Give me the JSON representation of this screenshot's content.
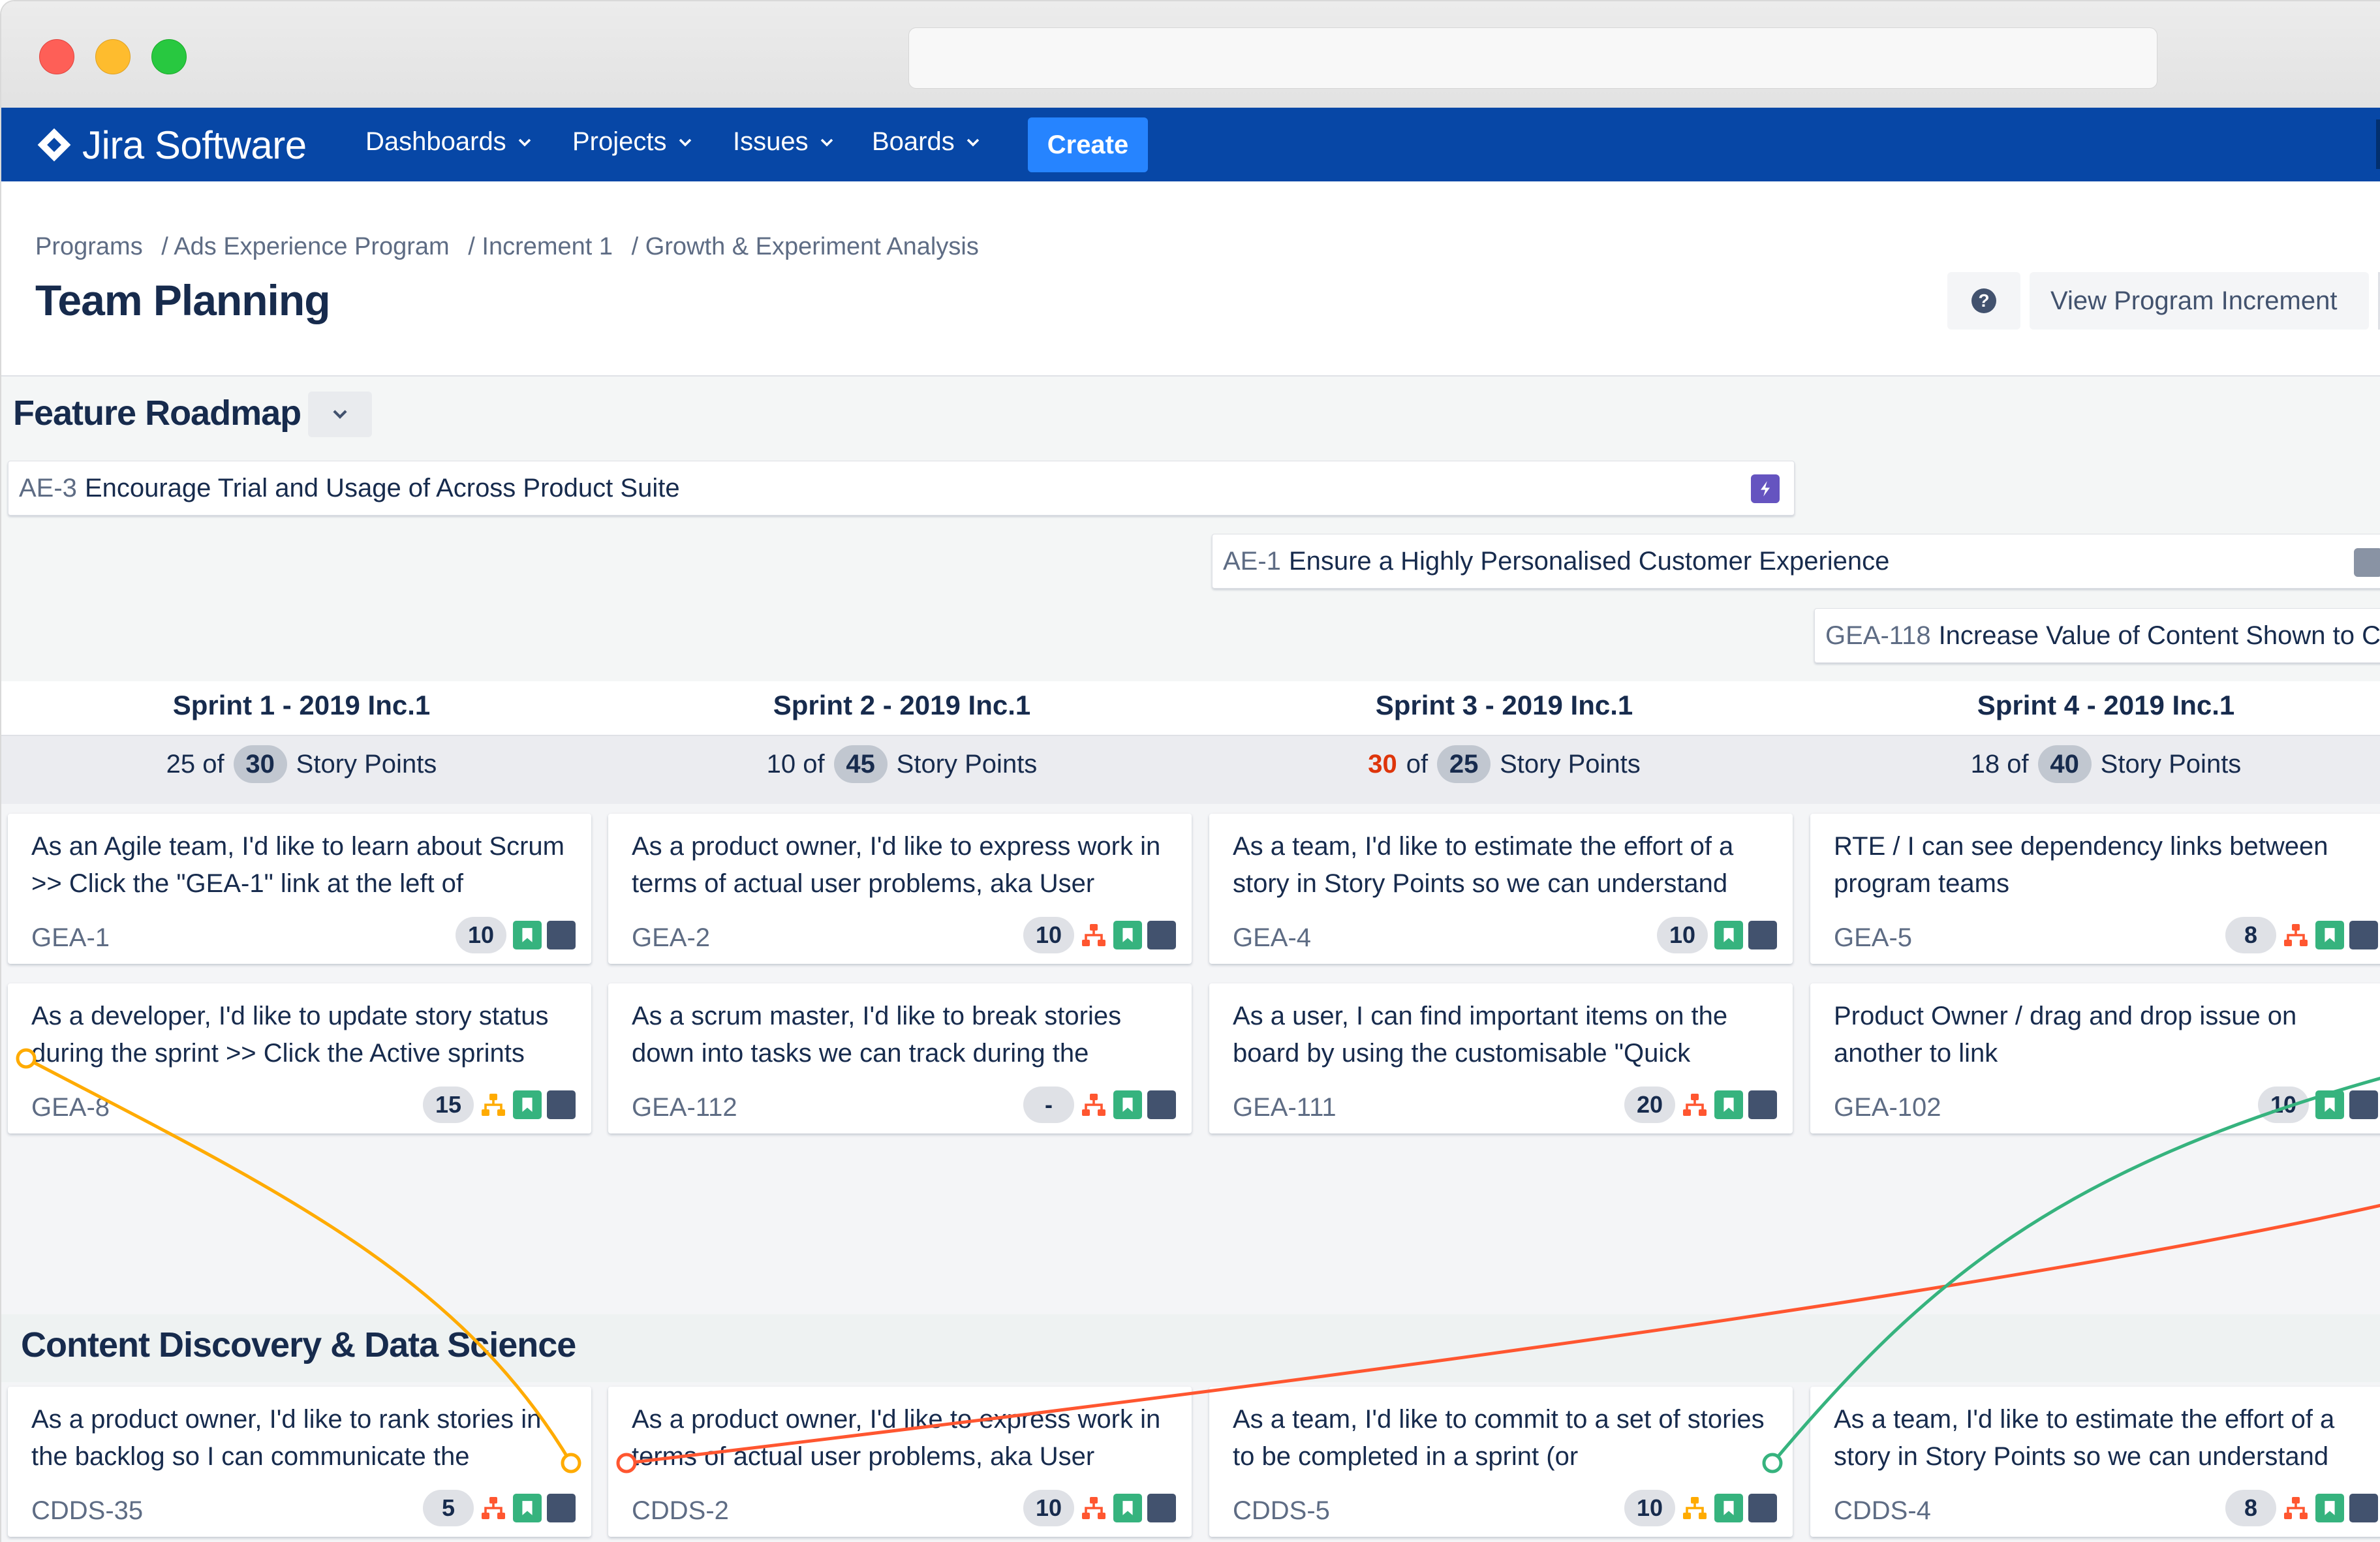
{
  "nav": {
    "brand": "Jira Software",
    "items": [
      {
        "label": "Dashboards"
      },
      {
        "label": "Projects"
      },
      {
        "label": "Issues"
      },
      {
        "label": "Boards"
      }
    ],
    "create_label": "Create",
    "colors": {
      "nav_bg": "#0747a6",
      "create_bg": "#2684ff"
    }
  },
  "header": {
    "breadcrumb": [
      "Programs",
      "/ Ads Experience Program",
      "/ Increment 1",
      "/ Growth & Experiment Analysis"
    ],
    "title": "Team Planning",
    "help_icon": "question-circle-icon",
    "view_program_increment_label": "View Program Increment"
  },
  "roadmap": {
    "title": "Feature Roadmap",
    "features": [
      {
        "key": "AE-3",
        "name": "Encourage Trial and Usage of Across Product Suite",
        "icon": "epic-lightning-icon"
      },
      {
        "key": "AE-1",
        "name": "Ensure a Highly Personalised Customer Experience",
        "icon": "epic-icon"
      },
      {
        "key": "GEA-118",
        "name": "Increase Value of Content Shown to C",
        "icon": ""
      }
    ]
  },
  "sprints": [
    {
      "name": "Sprint 1 - 2019 Inc.1",
      "used": "25",
      "of": "of",
      "capacity": "30",
      "unit": "Story Points",
      "over": false
    },
    {
      "name": "Sprint 2 - 2019 Inc.1",
      "used": "10",
      "of": "of",
      "capacity": "45",
      "unit": "Story Points",
      "over": false
    },
    {
      "name": "Sprint 3 - 2019 Inc.1",
      "used": "30",
      "of": "of",
      "capacity": "25",
      "unit": "Story Points",
      "over": true
    },
    {
      "name": "Sprint 4 - 2019 Inc.1",
      "used": "18",
      "of": "of",
      "capacity": "40",
      "unit": "Story Points",
      "over": false
    }
  ],
  "team_gea": {
    "cards": [
      {
        "summary": "As an Agile team, I'd like to learn about Scrum >> Click the \"GEA-1\" link at the left of",
        "key": "GEA-1",
        "points": "10",
        "dependency": "",
        "issue_type": "story-icon",
        "status": "status-icon"
      },
      {
        "summary": "As a product owner, I'd like to express work in terms of actual user problems, aka User",
        "key": "GEA-2",
        "points": "10",
        "dependency": "red",
        "issue_type": "story-icon",
        "status": "status-icon"
      },
      {
        "summary": "As a team, I'd like to estimate the effort of a story in Story Points so we can understand",
        "key": "GEA-4",
        "points": "10",
        "dependency": "",
        "issue_type": "story-icon",
        "status": "status-icon"
      },
      {
        "summary": "RTE / I can see dependency links between program teams",
        "key": "GEA-5",
        "points": "8",
        "dependency": "red",
        "issue_type": "story-icon",
        "status": "status-icon"
      },
      {
        "summary": "As a developer, I'd like to update story status during the sprint >> Click the Active sprints",
        "key": "GEA-8",
        "points": "15",
        "dependency": "orange",
        "issue_type": "story-icon",
        "status": "status-icon"
      },
      {
        "summary": "As a scrum master, I'd like to break stories down into tasks we can track during the",
        "key": "GEA-112",
        "points": "-",
        "dependency": "red",
        "issue_type": "story-icon",
        "status": "status-icon"
      },
      {
        "summary": "As a user, I can find important items on the board by using the customisable \"Quick",
        "key": "GEA-111",
        "points": "20",
        "dependency": "red",
        "issue_type": "story-icon",
        "status": "status-icon"
      },
      {
        "summary": "Product Owner / drag and drop issue on another to link",
        "key": "GEA-102",
        "points": "10",
        "dependency": "",
        "issue_type": "story-icon",
        "status": "status-icon"
      }
    ]
  },
  "team_cdds": {
    "title": "Content Discovery & Data Science",
    "cards": [
      {
        "summary": "As a product owner, I'd like to rank stories in the backlog so I can communicate the",
        "key": "CDDS-35",
        "points": "5",
        "dependency": "red",
        "issue_type": "story-icon",
        "status": "status-icon"
      },
      {
        "summary": "As a product owner, I'd like to express work in terms of actual user problems, aka User",
        "key": "CDDS-2",
        "points": "10",
        "dependency": "red",
        "issue_type": "story-icon",
        "status": "status-icon"
      },
      {
        "summary": "As a team, I'd like to commit to a set of stories to be completed in a sprint (or",
        "key": "CDDS-5",
        "points": "10",
        "dependency": "orange",
        "issue_type": "story-icon",
        "status": "status-icon"
      },
      {
        "summary": "As a team, I'd like to estimate the effort of a story in Story Points so we can understand",
        "key": "CDDS-4",
        "points": "8",
        "dependency": "red",
        "issue_type": "story-icon",
        "status": "status-icon"
      }
    ]
  },
  "dependency_colors": {
    "orange": "#ffab00",
    "red": "#ff5630",
    "green": "#36b37e"
  }
}
